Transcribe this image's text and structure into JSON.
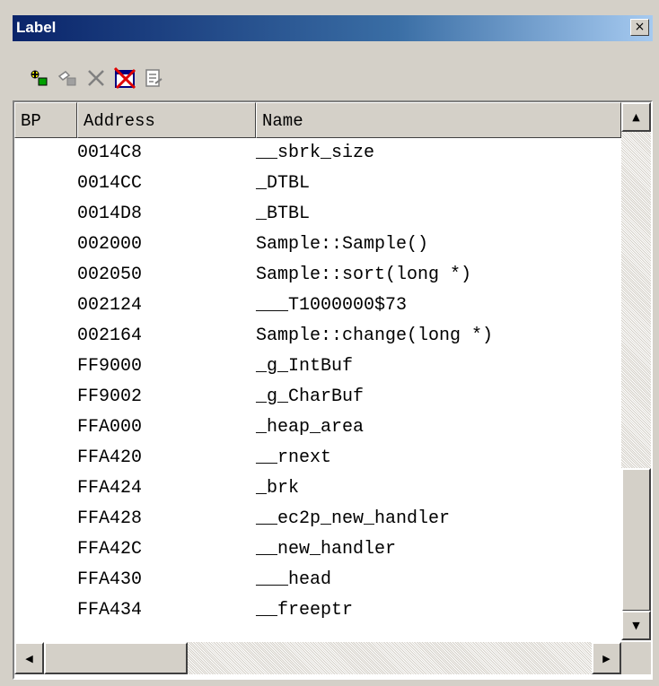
{
  "window": {
    "title": "Label",
    "close_glyph": "×"
  },
  "toolbar": {
    "buttons": [
      {
        "icon": "add-label-icon"
      },
      {
        "icon": "edit-label-icon"
      },
      {
        "icon": "delete-label-icon"
      },
      {
        "icon": "delete-all-icon"
      },
      {
        "icon": "properties-icon"
      }
    ]
  },
  "table": {
    "columns": [
      "BP",
      "Address",
      "Name"
    ],
    "rows": [
      {
        "address": "0014C8",
        "name": "__sbrk_size"
      },
      {
        "address": "0014CC",
        "name": "_DTBL"
      },
      {
        "address": "0014D8",
        "name": "_BTBL"
      },
      {
        "address": "002000",
        "name": "Sample::Sample()"
      },
      {
        "address": "002050",
        "name": "Sample::sort(long *)"
      },
      {
        "address": "002124",
        "name": "___T1000000$73"
      },
      {
        "address": "002164",
        "name": "Sample::change(long *)"
      },
      {
        "address": "FF9000",
        "name": "_g_IntBuf"
      },
      {
        "address": "FF9002",
        "name": "_g_CharBuf"
      },
      {
        "address": "FFA000",
        "name": "_heap_area"
      },
      {
        "address": "FFA420",
        "name": "__rnext"
      },
      {
        "address": "FFA424",
        "name": "_brk"
      },
      {
        "address": "FFA428",
        "name": "__ec2p_new_handler"
      },
      {
        "address": "FFA42C",
        "name": "__new_handler"
      },
      {
        "address": "FFA430",
        "name": "___head"
      },
      {
        "address": "FFA434",
        "name": "__freeptr"
      }
    ]
  },
  "scrollbars": {
    "up_glyph": "▲",
    "down_glyph": "▼",
    "left_glyph": "◀",
    "right_glyph": "▶",
    "vertical_position": 0.82,
    "horizontal_position": 0.0
  }
}
